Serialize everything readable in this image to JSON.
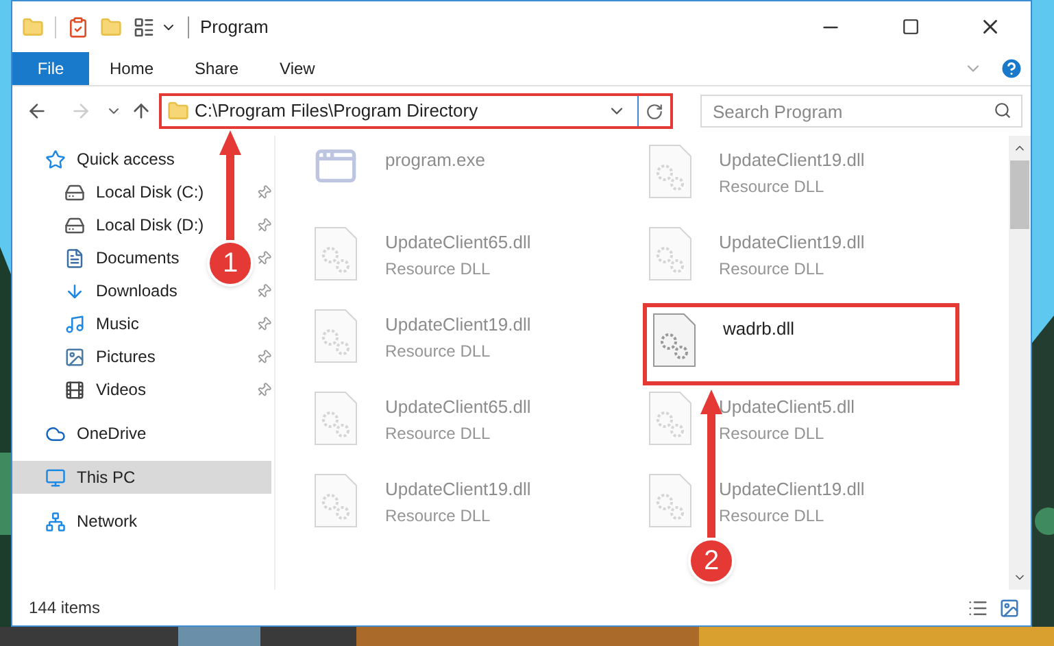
{
  "window": {
    "title": "Program"
  },
  "ribbon_tabs": [
    {
      "label": "File",
      "selected": true
    },
    {
      "label": "Home",
      "selected": false
    },
    {
      "label": "Share",
      "selected": false
    },
    {
      "label": "View",
      "selected": false
    }
  ],
  "address": {
    "path": "C:\\Program Files\\Program Directory",
    "annotated": true
  },
  "search": {
    "placeholder": "Search Program"
  },
  "sidebar": {
    "items": [
      {
        "label": "Quick access",
        "kind": "star",
        "selected": false,
        "children": [
          {
            "label": "Local Disk (C:)",
            "kind": "drive",
            "pinned": true,
            "selected": false
          },
          {
            "label": "Local Disk (D:)",
            "kind": "drive",
            "pinned": true,
            "selected": false
          },
          {
            "label": "Documents",
            "kind": "documents",
            "pinned": true,
            "selected": false
          },
          {
            "label": "Downloads",
            "kind": "downloads",
            "pinned": true,
            "selected": false
          },
          {
            "label": "Music",
            "kind": "music",
            "pinned": true,
            "selected": false
          },
          {
            "label": "Pictures",
            "kind": "pictures",
            "pinned": true,
            "selected": false
          },
          {
            "label": "Videos",
            "kind": "videos",
            "pinned": true,
            "selected": false
          }
        ]
      },
      {
        "label": "OneDrive",
        "kind": "cloud",
        "selected": false
      },
      {
        "label": "This PC",
        "kind": "pc",
        "selected": true
      },
      {
        "label": "Network",
        "kind": "network",
        "selected": false
      }
    ]
  },
  "files": [
    {
      "name": "program.exe",
      "kind": "exe",
      "faded": true,
      "annotated": false
    },
    {
      "name": "UpdateClient19.dll",
      "type": "Resource DLL",
      "kind": "dll",
      "faded": true,
      "annotated": false
    },
    {
      "name": "UpdateClient65.dll",
      "type": "Resource DLL",
      "kind": "dll",
      "faded": true,
      "annotated": false
    },
    {
      "name": "UpdateClient19.dll",
      "type": "Resource DLL",
      "kind": "dll",
      "faded": true,
      "annotated": false
    },
    {
      "name": "UpdateClient19.dll",
      "type": "Resource DLL",
      "kind": "dll",
      "faded": true,
      "annotated": false
    },
    {
      "name": "wadrb.dll",
      "kind": "dll",
      "faded": false,
      "annotated": true
    },
    {
      "name": "UpdateClient65.dll",
      "type": "Resource DLL",
      "kind": "dll",
      "faded": true,
      "annotated": false
    },
    {
      "name": "UpdateClient5.dll",
      "type": "Resource DLL",
      "kind": "dll",
      "faded": true,
      "annotated": false
    },
    {
      "name": "UpdateClient19.dll",
      "type": "Resource DLL",
      "kind": "dll",
      "faded": true,
      "annotated": false
    },
    {
      "name": "UpdateClient19.dll",
      "type": "Resource DLL",
      "kind": "dll",
      "faded": true,
      "annotated": false
    }
  ],
  "status_bar": {
    "count": "144 items"
  },
  "annotations": [
    {
      "label": "1"
    },
    {
      "label": "2"
    }
  ]
}
